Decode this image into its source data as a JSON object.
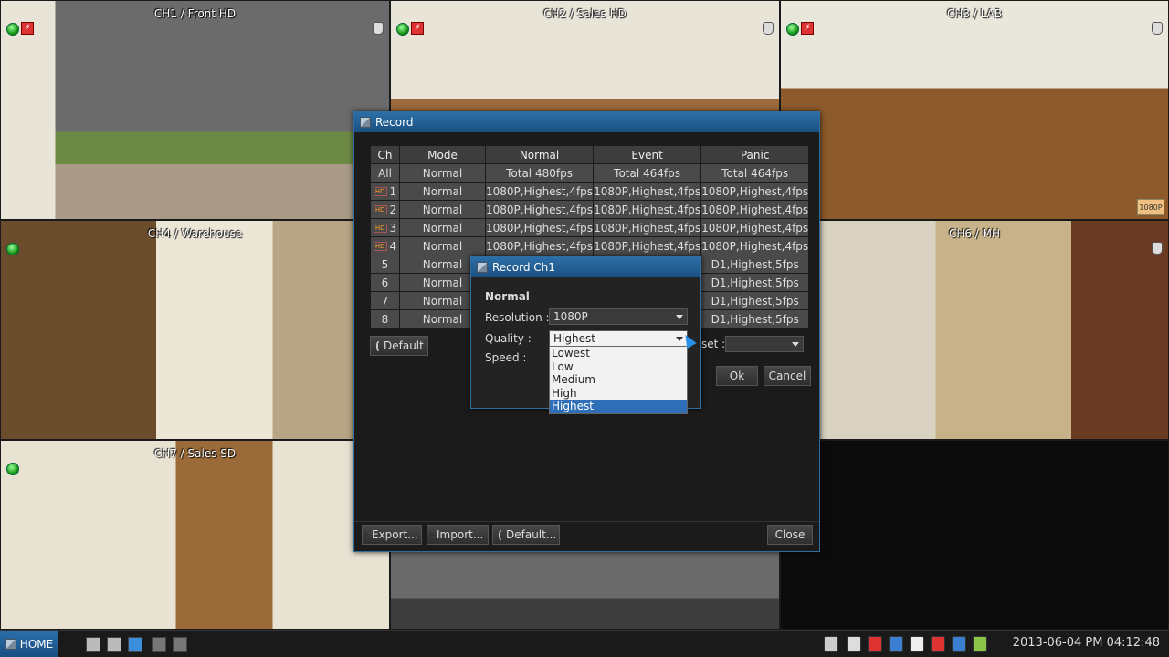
{
  "cameras": [
    {
      "title": "CH1 / Front HD",
      "has_motion": true
    },
    {
      "title": "CH2 / Sales HD",
      "has_motion": true
    },
    {
      "title": "CH3 / LAB",
      "has_motion": true,
      "tag": "1080P"
    },
    {
      "title": "CH4 / Warehouse"
    },
    {
      "title": "CH6 / MH"
    },
    {
      "title": "CH7 / Sales SD"
    }
  ],
  "record_dialog": {
    "title": "Record",
    "columns": [
      "Ch",
      "Mode",
      "Normal",
      "Event",
      "Panic"
    ],
    "rows": [
      {
        "ch": "All",
        "mode": "Normal",
        "normal": "Total 480fps",
        "event": "Total 464fps",
        "panic": "Total 464fps",
        "hd": false
      },
      {
        "ch": "1",
        "mode": "Normal",
        "normal": "1080P,Highest,4fps",
        "event": "1080P,Highest,4fps",
        "panic": "1080P,Highest,4fps",
        "hd": true
      },
      {
        "ch": "2",
        "mode": "Normal",
        "normal": "1080P,Highest,4fps",
        "event": "1080P,Highest,4fps",
        "panic": "1080P,Highest,4fps",
        "hd": true
      },
      {
        "ch": "3",
        "mode": "Normal",
        "normal": "1080P,Highest,4fps",
        "event": "1080P,Highest,4fps",
        "panic": "1080P,Highest,4fps",
        "hd": true
      },
      {
        "ch": "4",
        "mode": "Normal",
        "normal": "1080P,Highest,4fps",
        "event": "1080P,Highest,4fps",
        "panic": "1080P,Highest,4fps",
        "hd": true
      },
      {
        "ch": "5",
        "mode": "Normal",
        "normal": "",
        "event": "",
        "panic": "D1,Highest,5fps",
        "hd": false
      },
      {
        "ch": "6",
        "mode": "Normal",
        "normal": "",
        "event": "",
        "panic": "D1,Highest,5fps",
        "hd": false
      },
      {
        "ch": "7",
        "mode": "Normal",
        "normal": "",
        "event": "",
        "panic": "D1,Highest,5fps",
        "hd": false
      },
      {
        "ch": "8",
        "mode": "Normal",
        "normal": "",
        "event": "",
        "panic": "D1,Highest,5fps",
        "hd": false
      }
    ],
    "hd_badge": "HD",
    "default_label": "Default",
    "preset_label": "set :",
    "preset_value": "",
    "ok_label": "Ok",
    "cancel_label": "Cancel",
    "export_label": "Export...",
    "import_label": "Import...",
    "default_bottom_label": "Default...",
    "close_label": "Close"
  },
  "record_ch1": {
    "title": "Record Ch1",
    "section": "Normal",
    "resolution_label": "Resolution :",
    "resolution_value": "1080P",
    "quality_label": "Quality :",
    "quality_value": "Highest",
    "speed_label": "Speed :",
    "quality_options": [
      "Lowest",
      "Low",
      "Medium",
      "High",
      "Highest"
    ],
    "quality_selected_index": 4
  },
  "taskbar": {
    "home_label": "HOME",
    "clock": "2013-06-04 PM 04:12:48"
  },
  "colors": {
    "accent": "#2b6fab",
    "selection": "#2f6fb7",
    "rec_green": "#1a9b1a",
    "motion_red": "#d33333"
  }
}
